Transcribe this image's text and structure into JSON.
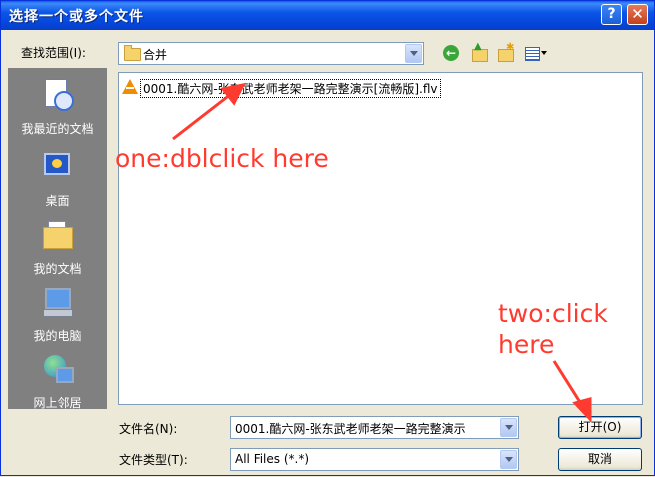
{
  "window": {
    "title": "选择一个或多个文件",
    "help_glyph": "?",
    "close_glyph": "✕"
  },
  "look_in": {
    "label": "查找范围(I):",
    "value": "合并"
  },
  "toolbar": {
    "icons": [
      "back-icon",
      "up-folder-icon",
      "new-folder-icon",
      "view-menu-icon"
    ]
  },
  "places": [
    {
      "label": "我最近的文档",
      "icon": "recent-documents-icon"
    },
    {
      "label": "桌面",
      "icon": "desktop-icon"
    },
    {
      "label": "我的文档",
      "icon": "my-documents-icon"
    },
    {
      "label": "我的电脑",
      "icon": "my-computer-icon"
    },
    {
      "label": "网上邻居",
      "icon": "network-places-icon"
    }
  ],
  "files": [
    {
      "name": "0001.酷六网-张东武老师老架一路完整演示[流畅版].flv",
      "icon": "vlc-icon"
    }
  ],
  "filename": {
    "label": "文件名(N):",
    "value": "0001.酷六网-张东武老师老架一路完整演示"
  },
  "filetype": {
    "label": "文件类型(T):",
    "value": "All Files (*.*)"
  },
  "buttons": {
    "open": "打开(O)",
    "cancel": "取消"
  },
  "annotations": {
    "first": "one:dblclick here",
    "second_line1": "two:click",
    "second_line2": "here",
    "color": "#ff3b30"
  }
}
